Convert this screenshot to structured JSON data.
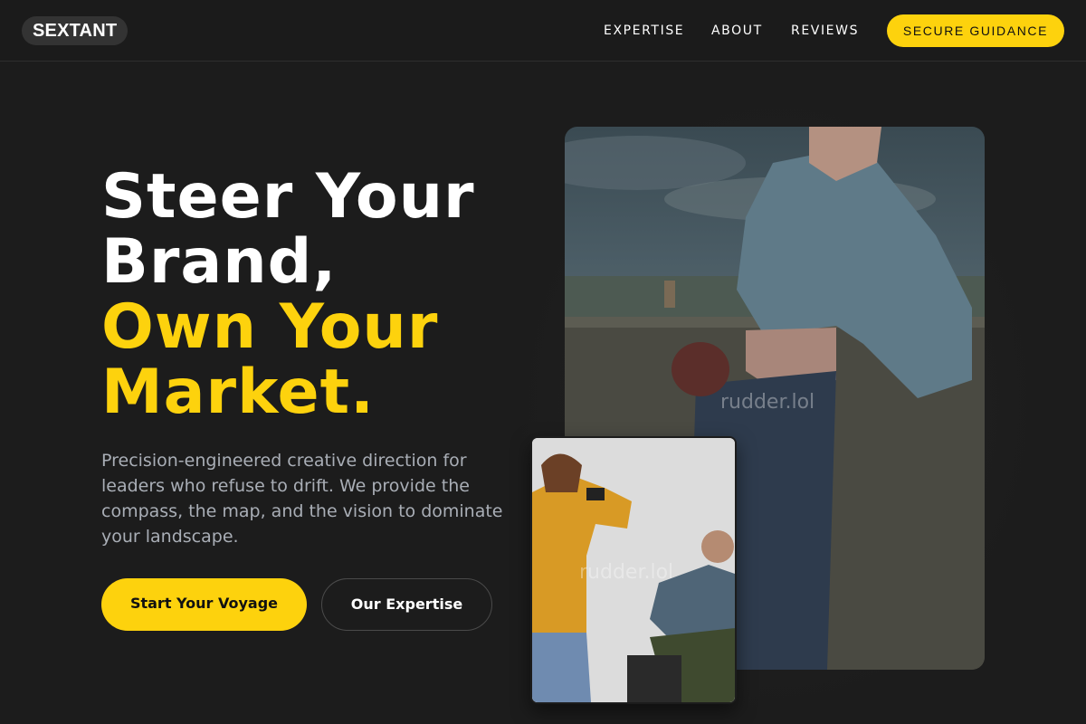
{
  "brand": {
    "logo_text": "SEXTANT"
  },
  "nav": {
    "items": [
      {
        "label": "EXPERTISE"
      },
      {
        "label": "ABOUT"
      },
      {
        "label": "REVIEWS"
      }
    ],
    "cta_label": "SECURE GUIDANCE"
  },
  "hero": {
    "headline_line1": "Steer Your",
    "headline_line2": "Brand,",
    "headline_line3": "Own Your",
    "headline_line4": "Market.",
    "lede": "Precision-engineered creative direction for leaders who refuse to drift. We provide the compass, the map, and the vision to dominate your landscape.",
    "primary_button": "Start Your Voyage",
    "secondary_button": "Our Expertise"
  },
  "images": {
    "main_watermark": "rudder.lol",
    "small_watermark": "rudder.lol"
  },
  "colors": {
    "background": "#1c1c1c",
    "accent": "#fdd20d",
    "muted_text": "#a9aeb6"
  }
}
